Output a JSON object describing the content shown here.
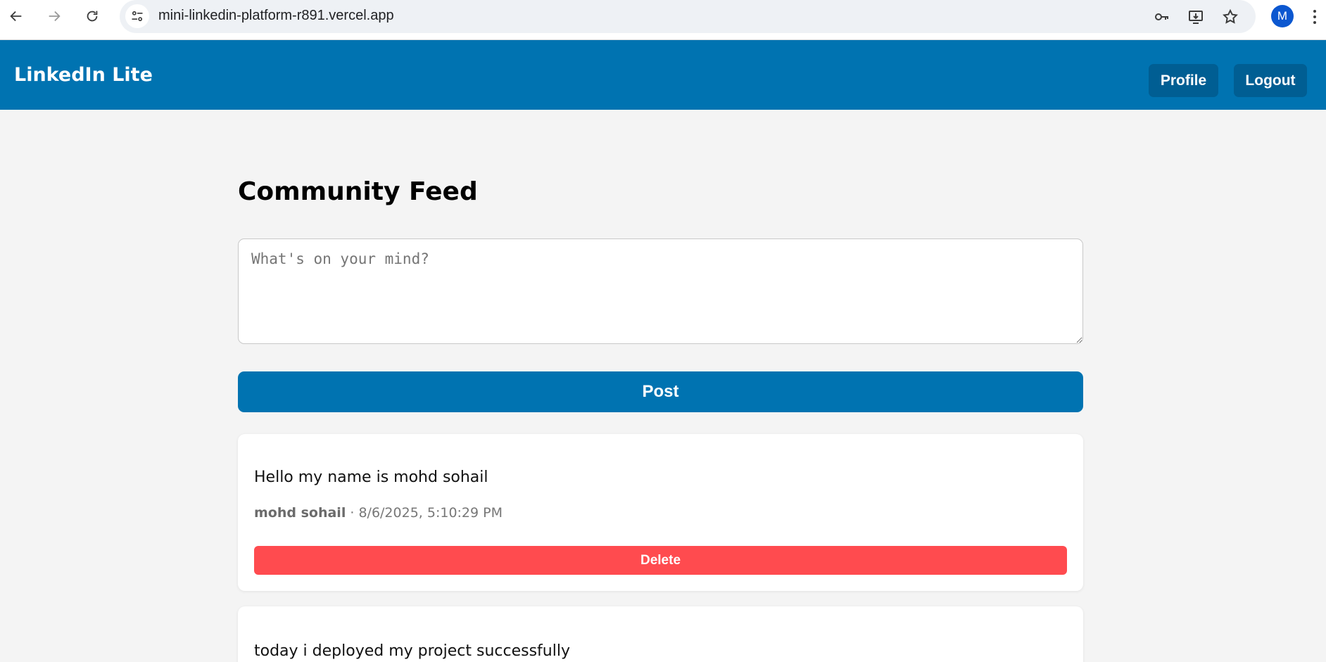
{
  "browser": {
    "url": "mini-linkedin-platform-r891.vercel.app",
    "profile_initial": "M",
    "icons": [
      "back-arrow-icon",
      "forward-arrow-icon",
      "reload-icon",
      "site-settings-icon",
      "password-key-icon",
      "install-app-icon",
      "bookmark-star-icon",
      "more-menu-icon"
    ]
  },
  "header": {
    "brand": "LinkedIn Lite",
    "profile_label": "Profile",
    "logout_label": "Logout",
    "color": "#0073b1"
  },
  "feed": {
    "title": "Community Feed",
    "composer_placeholder": "What's on your mind?",
    "post_label": "Post"
  },
  "posts": [
    {
      "text": "Hello my name is mohd sohail",
      "author": "mohd sohail",
      "separator": " · ",
      "timestamp": "8/6/2025, 5:10:29 PM",
      "delete_label": "Delete"
    },
    {
      "text": "today i deployed my project successfully"
    }
  ],
  "colors": {
    "primary": "#0073b1",
    "danger": "#ff4b4f",
    "background": "#f4f4f4"
  }
}
